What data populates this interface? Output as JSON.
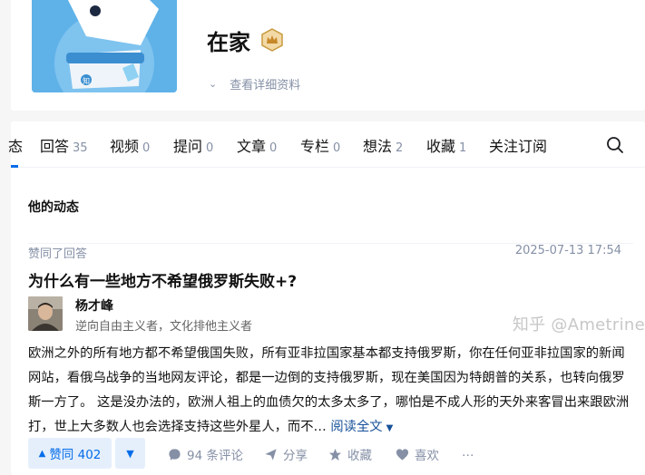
{
  "profile": {
    "name": "在家",
    "detail_link": "查看详细资料",
    "badge_icon": "crown-badge-icon"
  },
  "tabs": {
    "cut_label": "态",
    "items": [
      {
        "label": "回答",
        "count": "35"
      },
      {
        "label": "视频",
        "count": "0"
      },
      {
        "label": "提问",
        "count": "0"
      },
      {
        "label": "文章",
        "count": "0"
      },
      {
        "label": "专栏",
        "count": "0"
      },
      {
        "label": "想法",
        "count": "2"
      },
      {
        "label": "收藏",
        "count": "1"
      },
      {
        "label": "关注订阅",
        "count": ""
      }
    ]
  },
  "feed": {
    "section_title": "他的动态",
    "item": {
      "action": "赞同了回答",
      "timestamp": "2025-07-13 17:54",
      "question_title": "为什么有一些地方不希望俄罗斯失败+?",
      "author_name": "杨才峰",
      "author_bio": "逆向自由主义者，文化排他主义者",
      "excerpt": "欧洲之外的所有地方都不希望俄国失败，所有亚非拉国家基本都支持俄罗斯，你在任何亚非拉国家的新闻网站，看俄乌战争的当地网友评论，都是一边倒的支持俄罗斯，现在美国因为特朗普的关系，也转向俄罗斯一方了。 这是没办法的，欧洲人祖上的血债欠的太多太多了，哪怕是不成人形的天外来客冒出来跟欧洲打，世上大多数人也会选择支持这些外星人，而不…",
      "read_more": "阅读全文",
      "vote_label": "赞同 402",
      "comments": "94 条评论",
      "share": "分享",
      "favorite": "收藏",
      "like": "喜欢",
      "more": "…"
    }
  },
  "watermark": "知乎 @Ametrine",
  "colors": {
    "accent": "#056de8",
    "muted": "#8590a6",
    "link": "#175199"
  }
}
